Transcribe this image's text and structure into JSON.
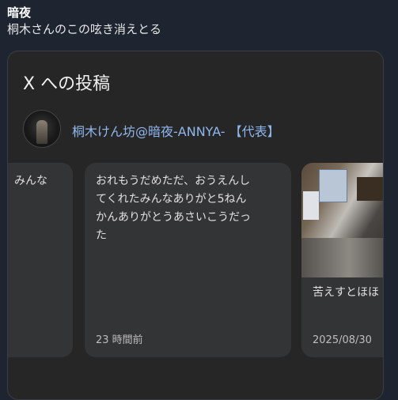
{
  "post": {
    "author": "暗夜",
    "text": "桐木さんのこの呟き消えとる"
  },
  "embed": {
    "title": "X への投稿",
    "account_name": "桐木けん坊@暗夜-ANNYA- 【代表】",
    "cards": [
      {
        "text": "みんな",
        "time": ""
      },
      {
        "text": "おれもうだめただ、おうえんし\nてくれたみんなありがと5ねん\nかんありがとうあさいこうだっ\nた",
        "time": "23 時間前"
      },
      {
        "text": "苦えすとほほ",
        "time": "2025/08/30"
      }
    ]
  }
}
